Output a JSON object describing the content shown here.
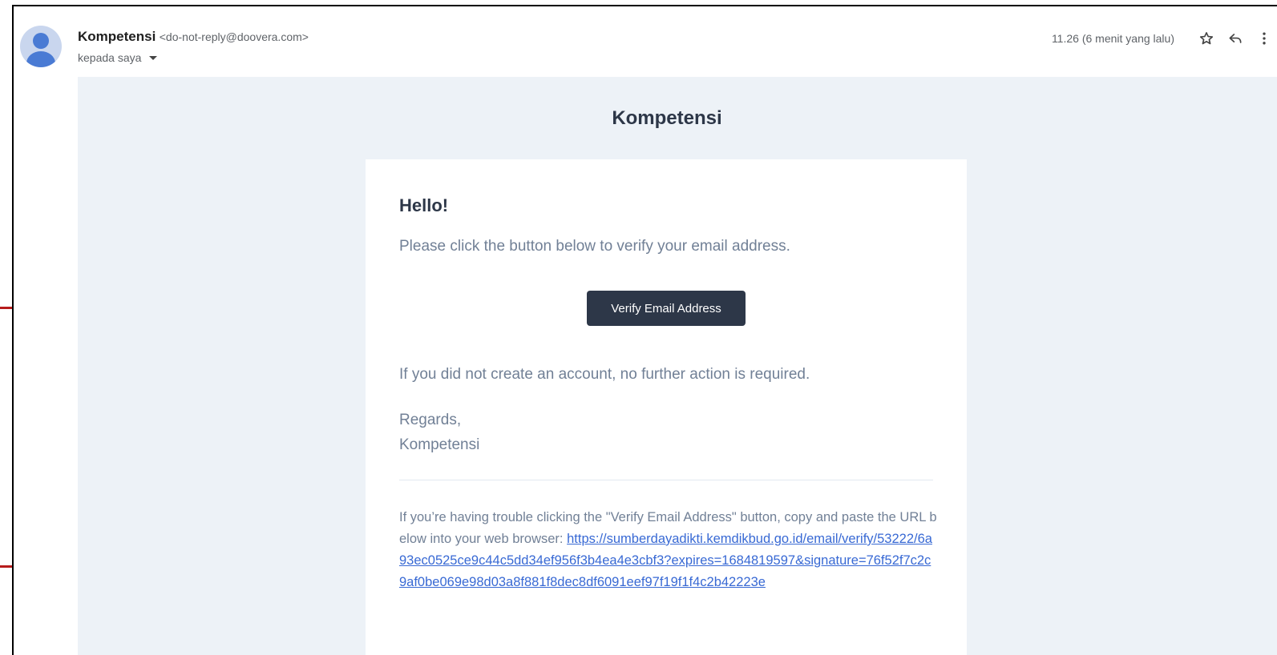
{
  "header": {
    "sender_name": "Kompetensi",
    "sender_email": "<do-not-reply@doovera.com>",
    "recipient": "kepada saya",
    "timestamp": "11.26 (6 menit yang lalu)",
    "icons": [
      "star-icon",
      "reply-icon",
      "more-vert-icon"
    ]
  },
  "email": {
    "brand_title": "Kompetensi",
    "greeting": "Hello!",
    "intro": "Please click the button below to verify your email address.",
    "button_label": "Verify Email Address",
    "no_action": "If you did not create an account, no further action is required.",
    "regards_line": "Regards,",
    "regards_name": "Kompetensi",
    "trouble_text": "If you’re having trouble clicking the \"Verify Email Address\" button, copy and paste the URL below into your web browser: ",
    "verify_url": "https://sumberdayadikti.kemdikbud.go.id/email/verify/53222/6a93ec0525ce9c44c5dd34ef956f3b4ea4e3cbf3?expires=1684819597&signature=76f52f7c2c9af0be069e98d03a8f881f8dec8df6091eef97f19f1f4c2b42223e"
  },
  "colors": {
    "annotation_line": "#b71c1c",
    "button_bg": "#2d3748",
    "link": "#3869d4"
  }
}
